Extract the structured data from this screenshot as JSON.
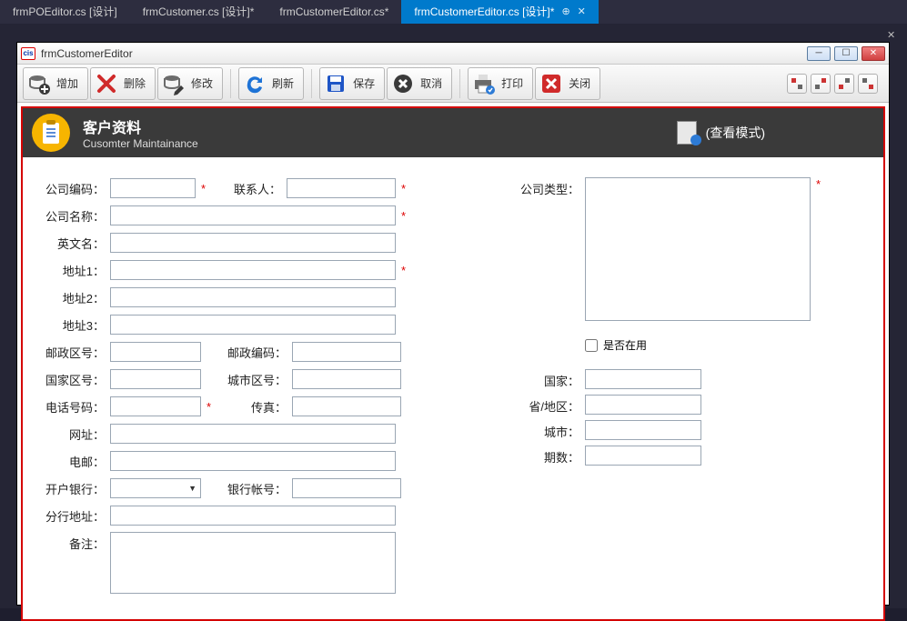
{
  "tabs": [
    {
      "label": "frmPOEditor.cs [设计]"
    },
    {
      "label": "frmCustomer.cs [设计]*"
    },
    {
      "label": "frmCustomerEditor.cs*"
    },
    {
      "label": "frmCustomerEditor.cs [设计]*"
    }
  ],
  "window": {
    "title": "frmCustomerEditor"
  },
  "toolbar": {
    "add": "增加",
    "delete": "删除",
    "edit": "修改",
    "refresh": "刷新",
    "save": "保存",
    "cancel": "取消",
    "print": "打印",
    "close": "关闭"
  },
  "banner": {
    "title_cn": "客户资料",
    "title_en": "Cusomter Maintainance",
    "mode": "(查看模式)"
  },
  "labels": {
    "company_code": "公司编码：",
    "contact": "联系人：",
    "company_name": "公司名称：",
    "english_name": "英文名：",
    "addr1": "地址1：",
    "addr2": "地址2：",
    "addr3": "地址3：",
    "postal_zone": "邮政区号：",
    "postal_code": "邮政编码：",
    "country_code": "国家区号：",
    "city_code": "城市区号：",
    "phone": "电话号码：",
    "fax": "传真：",
    "website": "网址：",
    "email": "电邮：",
    "bank": "开户银行：",
    "bank_account": "银行帐号：",
    "branch_addr": "分行地址：",
    "remark": "备注：",
    "company_type": "公司类型：",
    "in_use": "是否在用",
    "country": "国家：",
    "province": "省/地区：",
    "city": "城市：",
    "periods": "期数："
  }
}
